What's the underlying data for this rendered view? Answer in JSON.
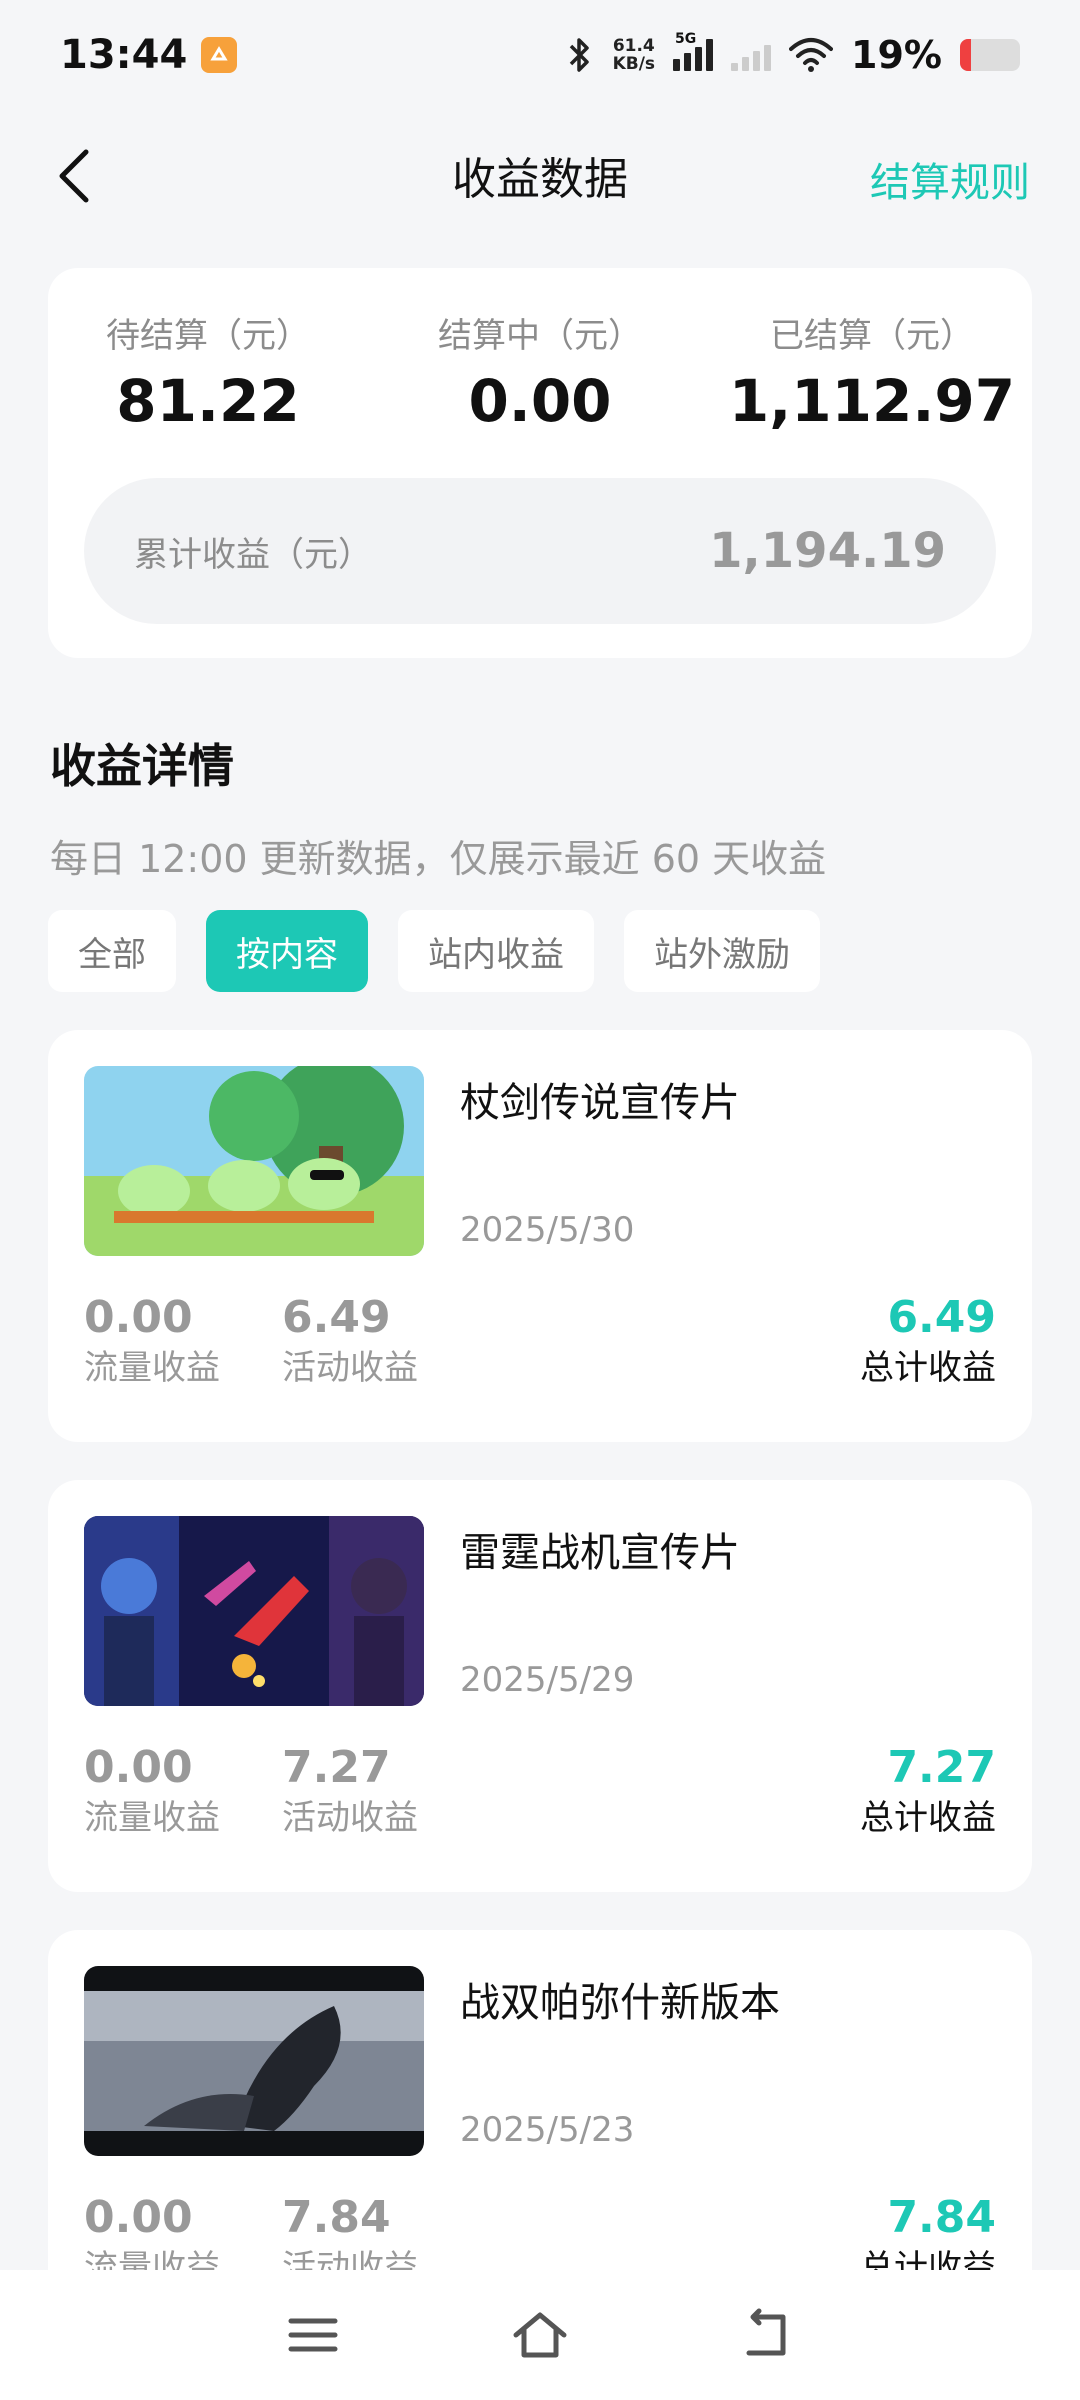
{
  "status_bar": {
    "time": "13:44",
    "net_speed_value": "61.4",
    "net_speed_unit": "KB/s",
    "net_type": "5G",
    "battery_percent": "19%",
    "battery_level": 0.19
  },
  "header": {
    "title": "收益数据",
    "rule_link": "结算规则"
  },
  "summary": {
    "pending": {
      "label": "待结算（元）",
      "value": "81.22"
    },
    "settling": {
      "label": "结算中（元）",
      "value": "0.00"
    },
    "settled": {
      "label": "已结算（元）",
      "value": "1,112.97"
    },
    "total": {
      "label": "累计收益（元）",
      "value": "1,194.19"
    }
  },
  "details": {
    "title": "收益详情",
    "subtitle": "每日 12:00 更新数据，仅展示最近 60 天收益",
    "filters": [
      "全部",
      "按内容",
      "站内收益",
      "站外激励"
    ],
    "active_filter": "按内容",
    "items": [
      {
        "title": "杖剑传说宣传片",
        "date": "2025/5/30",
        "traffic_value": "0.00",
        "traffic_label": "流量收益",
        "activity_value": "6.49",
        "activity_label": "活动收益",
        "total_value": "6.49",
        "total_label": "总计收益"
      },
      {
        "title": "雷霆战机宣传片",
        "date": "2025/5/29",
        "traffic_value": "0.00",
        "traffic_label": "流量收益",
        "activity_value": "7.27",
        "activity_label": "活动收益",
        "total_value": "7.27",
        "total_label": "总计收益"
      },
      {
        "title": "战双帕弥什新版本",
        "date": "2025/5/23",
        "traffic_value": "0.00",
        "traffic_label": "流量收益",
        "activity_value": "7.84",
        "activity_label": "活动收益",
        "total_value": "7.84",
        "total_label": "总计收益"
      }
    ]
  },
  "colors": {
    "accent": "#1dc8b5",
    "background": "#f5f6f8",
    "battery_low": "#ef4040"
  },
  "icons": {
    "back": "chevron-left-icon",
    "bluetooth": "bluetooth-icon",
    "wifi": "wifi-icon",
    "menu": "menu-icon",
    "home": "home-icon",
    "return": "return-icon"
  }
}
